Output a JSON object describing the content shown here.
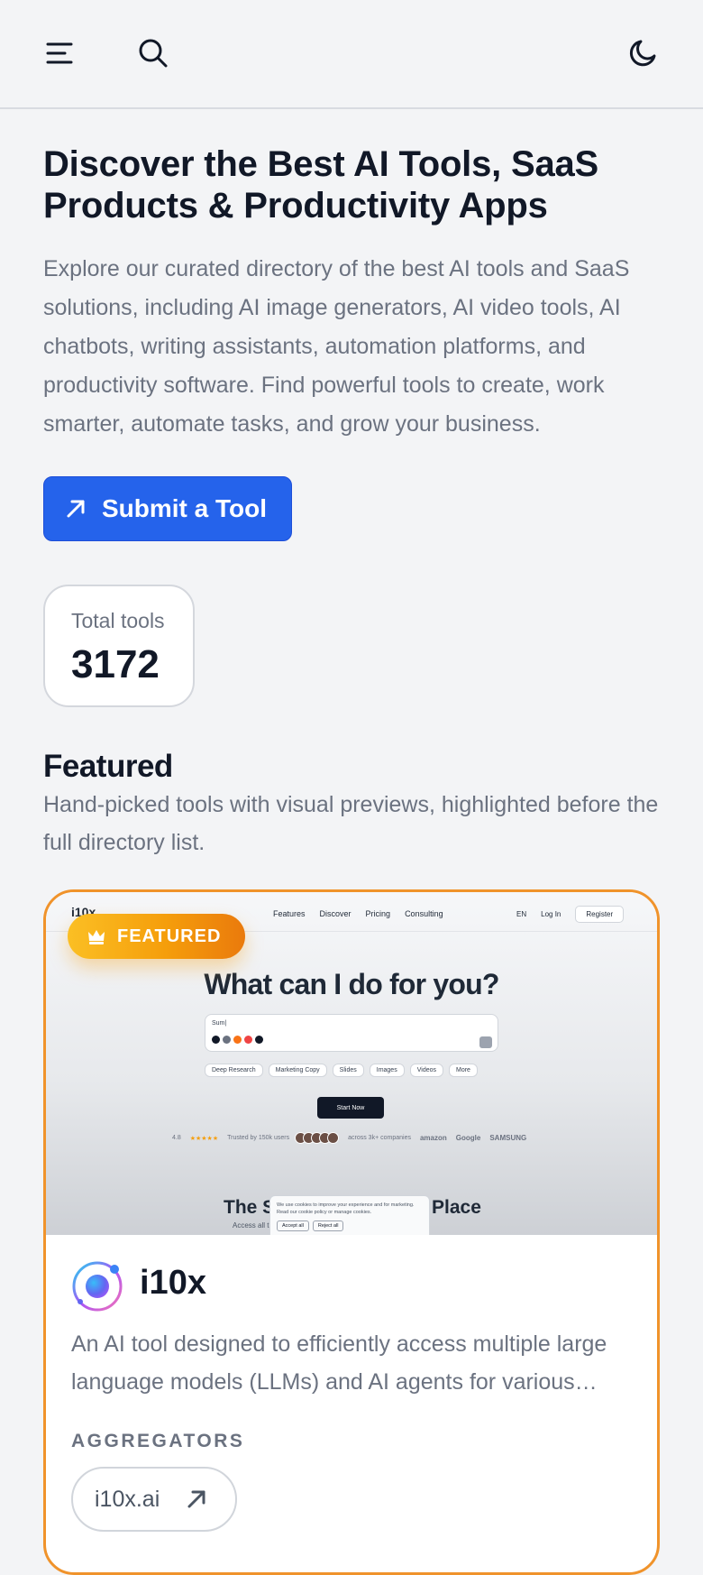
{
  "header": {
    "menu_icon": "menu-icon",
    "search_icon": "search-icon",
    "theme_icon": "moon-icon"
  },
  "hero": {
    "title": "Discover the Best AI Tools, SaaS Products & Productivity Apps",
    "description": "Explore our curated directory of the best AI tools and SaaS solutions, including AI image generators, AI video tools, AI chatbots, writing assistants, automation platforms, and productivity software. Find powerful tools to create, work smarter, automate tasks, and grow your business.",
    "submit_label": "Submit a Tool",
    "submit_icon": "arrow-up-right-icon"
  },
  "stats": {
    "label": "Total tools",
    "value": "3172"
  },
  "featured": {
    "title": "Featured",
    "description": "Hand-picked tools with visual previews, highlighted before the full directory list.",
    "cards": [
      {
        "badge": "FEATURED",
        "badge_icon": "crown-icon",
        "name": "i10x",
        "description": "An AI tool designed to efficiently access multiple large language models (LLMs) and AI agents for various tasks.",
        "category": "AGGREGATORS",
        "link_label": "i10x.ai",
        "link_icon": "arrow-up-right-icon",
        "preview": {
          "logo": "i10x",
          "nav_links": [
            "Features",
            "Discover",
            "Pricing",
            "Consulting"
          ],
          "lang": "EN",
          "login": "Log In",
          "register": "Register",
          "headline": "What can I do for you?",
          "input_text": "Sum|",
          "chips": [
            "Deep Research",
            "Marketing Copy",
            "Slides",
            "Images",
            "Videos",
            "More"
          ],
          "start_label": "Start Now",
          "rating": "4.8",
          "stars": "★★★★★",
          "trusted": "Trusted by 150k users",
          "companies": "across 3k+ companies",
          "brands": [
            "amazon",
            "Google",
            "SAMSUNG"
          ],
          "subhead_left": "The S",
          "subhead_right": "Place",
          "subtext": "Access all t",
          "cookie_text": "We use cookies to improve your experience and for marketing. Read our cookie policy or manage cookies.",
          "cookie_accept": "Accept all",
          "cookie_reject": "Reject all"
        }
      }
    ]
  },
  "colors": {
    "accent": "#2563eb",
    "featured_border": "#f0932b",
    "badge_start": "#fbbf24",
    "badge_end": "#ea7a0c",
    "background": "#f3f4f6"
  }
}
